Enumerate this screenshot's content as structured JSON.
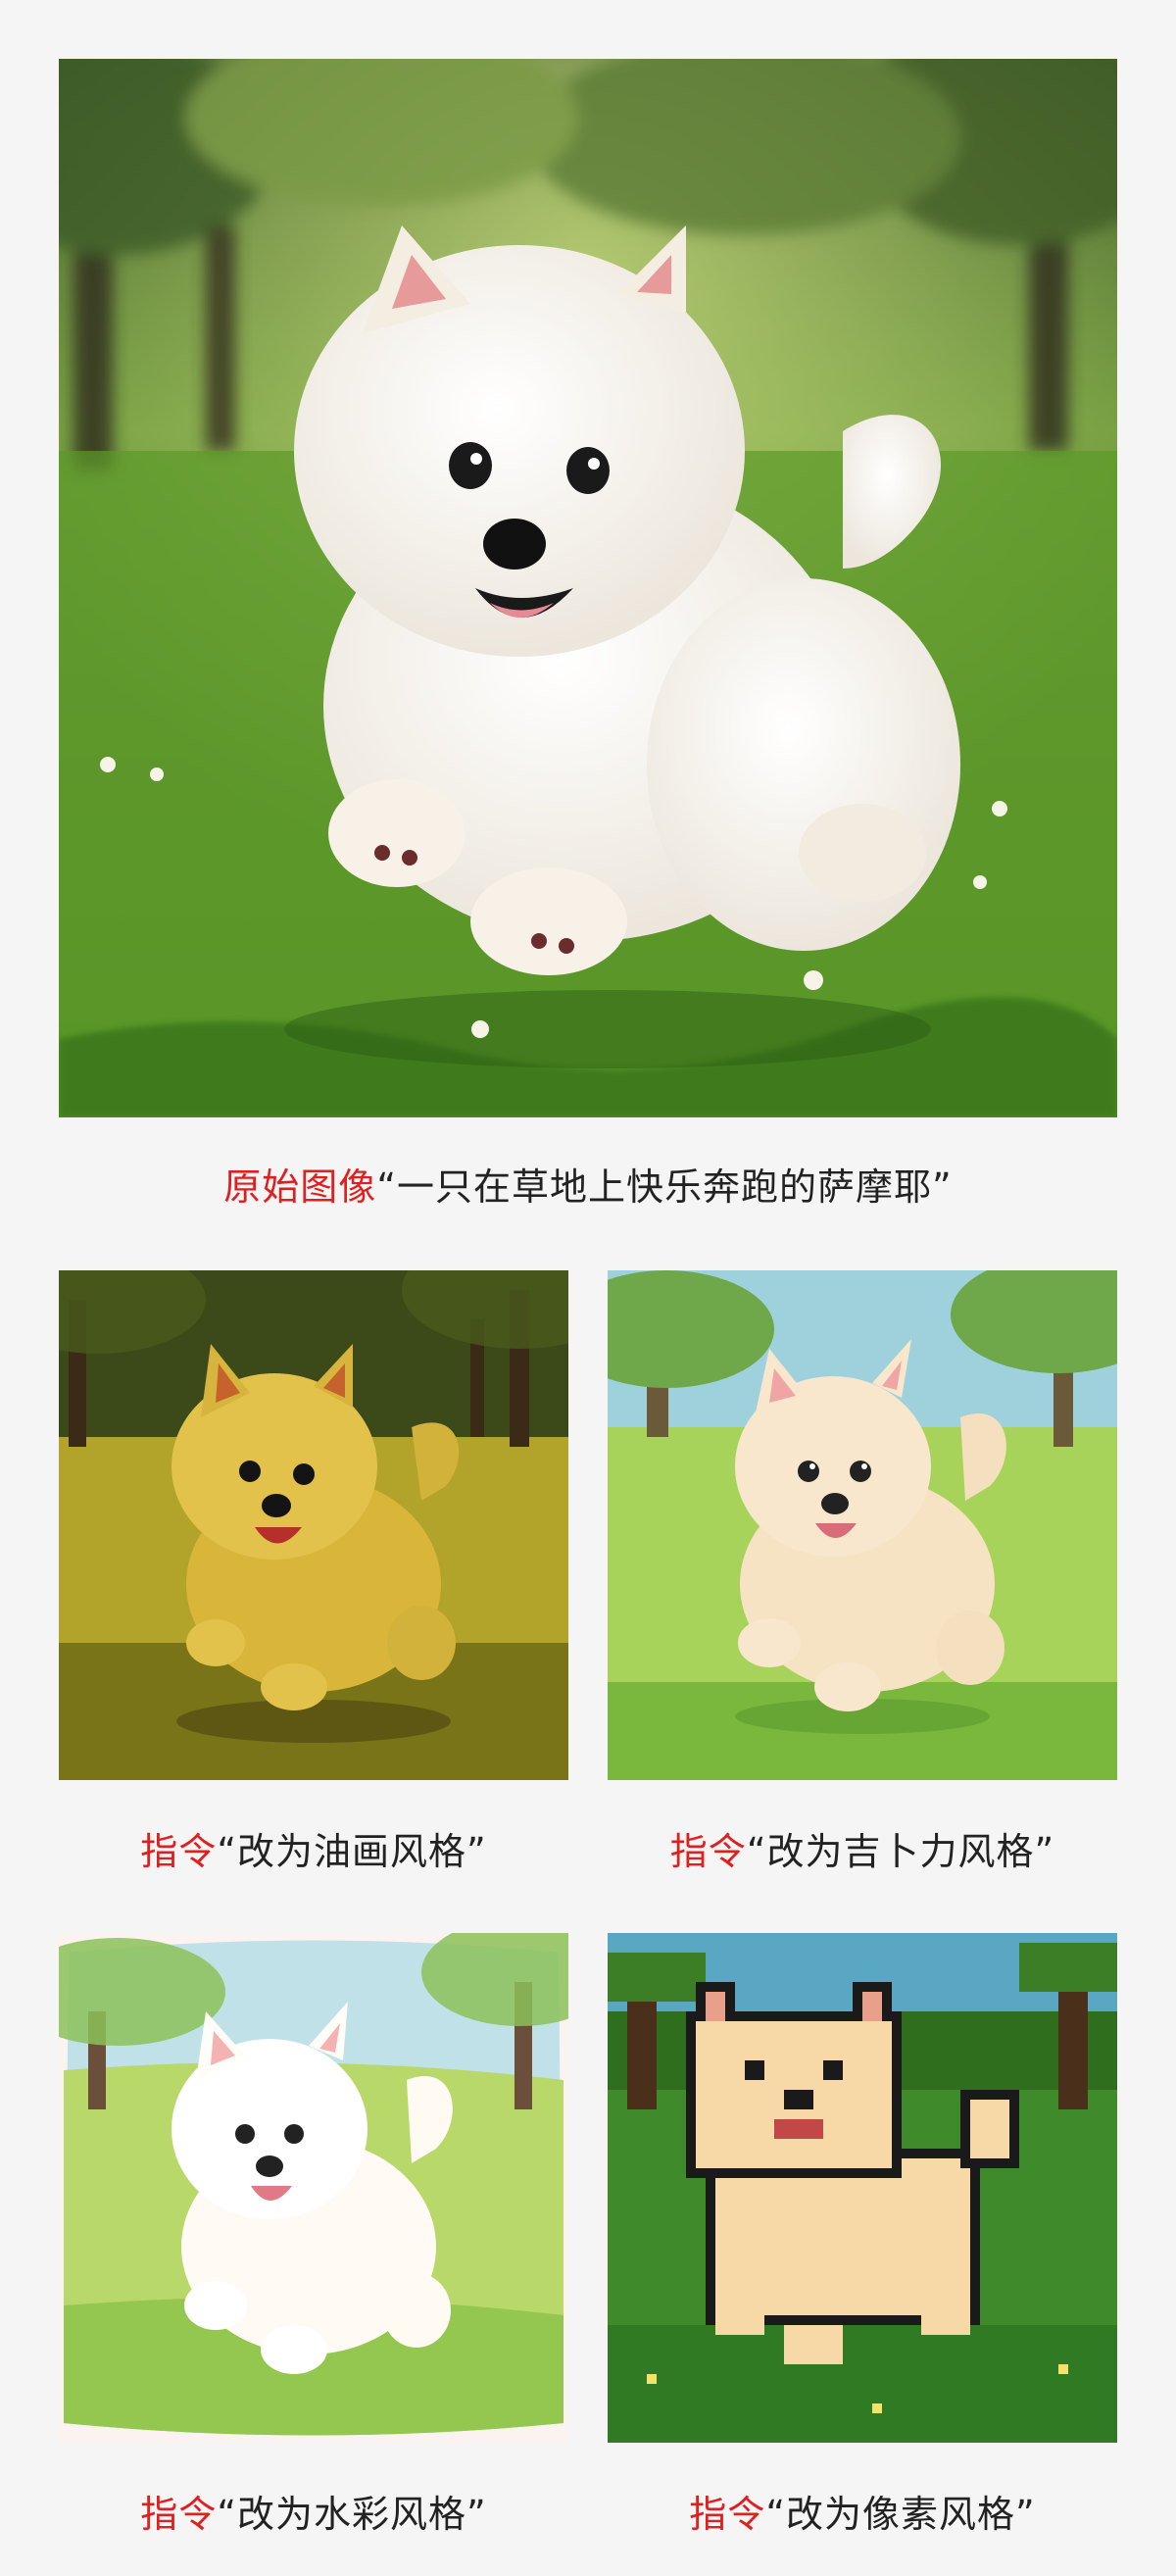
{
  "main": {
    "image_alt": "萨摩耶在草地上奔跑",
    "caption_label": "原始图像",
    "caption_text": "“一只在草地上快乐奔跑的萨摩耶”"
  },
  "variants": [
    {
      "caption_label": "指令",
      "caption_text": "“改为油画风格”",
      "style": "oil-painting"
    },
    {
      "caption_label": "指令",
      "caption_text": "“改为吉卜力风格”",
      "style": "ghibli"
    },
    {
      "caption_label": "指令",
      "caption_text": "“改为水彩风格”",
      "style": "watercolor"
    },
    {
      "caption_label": "指令",
      "caption_text": "“改为像素风格”",
      "style": "pixel-art"
    }
  ],
  "colors": {
    "label_red": "#e01f1f",
    "caption_text": "#222222",
    "page_bg": "#f5f5f5"
  }
}
